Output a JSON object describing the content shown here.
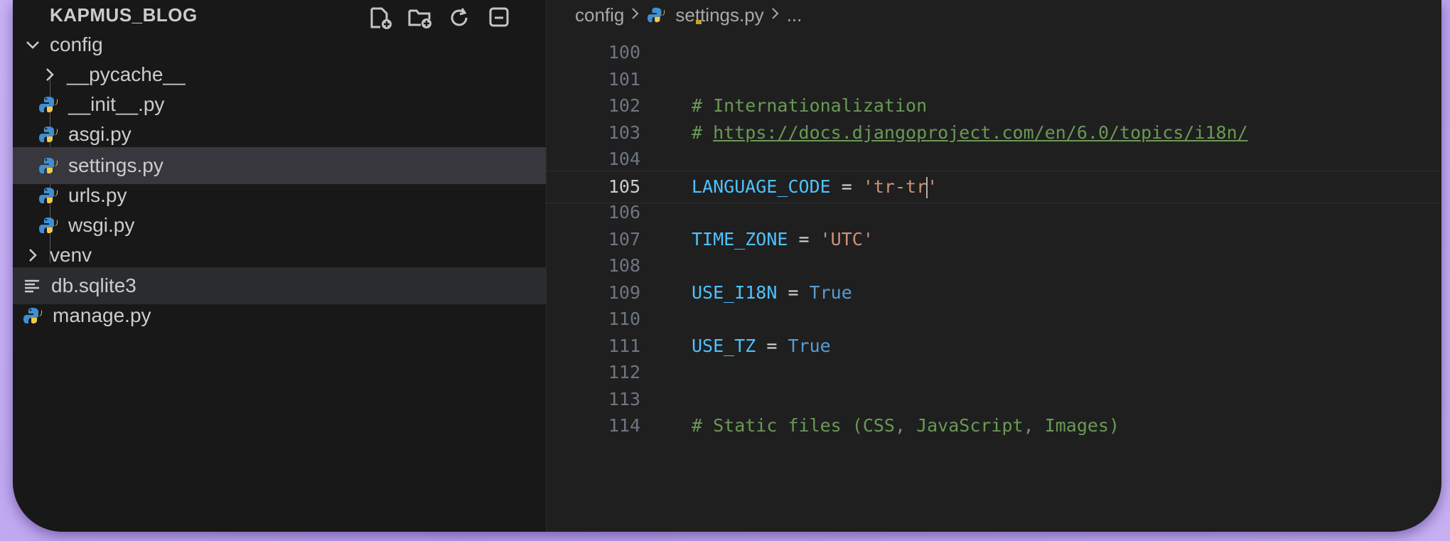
{
  "explorer": {
    "title": "KAPMUS_BLOG",
    "actions": [
      "new-file-icon",
      "new-folder-icon",
      "refresh-icon",
      "collapse-all-icon"
    ],
    "items": [
      {
        "label": "config",
        "kind": "folder",
        "expanded": true,
        "depth": 0
      },
      {
        "label": "__pycache__",
        "kind": "folder",
        "expanded": false,
        "depth": 1
      },
      {
        "label": "__init__.py",
        "kind": "python",
        "depth": 1
      },
      {
        "label": "asgi.py",
        "kind": "python",
        "depth": 1
      },
      {
        "label": "settings.py",
        "kind": "python",
        "depth": 1,
        "selected": true
      },
      {
        "label": "urls.py",
        "kind": "python",
        "depth": 1
      },
      {
        "label": "wsgi.py",
        "kind": "python",
        "depth": 1
      },
      {
        "label": "venv",
        "kind": "folder",
        "expanded": false,
        "depth": 0
      },
      {
        "label": "db.sqlite3",
        "kind": "database",
        "depth": 0
      },
      {
        "label": "manage.py",
        "kind": "python",
        "depth": 0
      }
    ]
  },
  "breadcrumb": {
    "folder": "config",
    "file": "settings.py",
    "more": "..."
  },
  "editor": {
    "current_line": "105",
    "lines": [
      {
        "n": "100",
        "tokens": []
      },
      {
        "n": "101",
        "tokens": []
      },
      {
        "n": "102",
        "tokens": [
          {
            "t": "comment",
            "v": "# Internationalization"
          }
        ]
      },
      {
        "n": "103",
        "tokens": [
          {
            "t": "comment",
            "v": "# "
          },
          {
            "t": "link",
            "v": "https://docs.djangoproject.com/en/6.0/topics/i18n/"
          }
        ]
      },
      {
        "n": "104",
        "tokens": []
      },
      {
        "n": "105",
        "tokens": [
          {
            "t": "var",
            "v": "LANGUAGE_CODE"
          },
          {
            "t": "op",
            "v": " = "
          },
          {
            "t": "str",
            "v": "'tr-tr"
          },
          {
            "t": "caret",
            "v": ""
          },
          {
            "t": "str",
            "v": "'"
          }
        ]
      },
      {
        "n": "106",
        "tokens": []
      },
      {
        "n": "107",
        "tokens": [
          {
            "t": "var",
            "v": "TIME_ZONE"
          },
          {
            "t": "op",
            "v": " = "
          },
          {
            "t": "str",
            "v": "'UTC'"
          }
        ]
      },
      {
        "n": "108",
        "tokens": []
      },
      {
        "n": "109",
        "tokens": [
          {
            "t": "var",
            "v": "USE_I18N"
          },
          {
            "t": "op",
            "v": " = "
          },
          {
            "t": "kw",
            "v": "True"
          }
        ]
      },
      {
        "n": "110",
        "tokens": []
      },
      {
        "n": "111",
        "tokens": [
          {
            "t": "var",
            "v": "USE_TZ"
          },
          {
            "t": "op",
            "v": " = "
          },
          {
            "t": "kw",
            "v": "True"
          }
        ]
      },
      {
        "n": "112",
        "tokens": []
      },
      {
        "n": "113",
        "tokens": []
      },
      {
        "n": "114",
        "tokens": [
          {
            "t": "comment",
            "v": "# Static files (CSS, JavaScript, Images)"
          }
        ]
      }
    ]
  },
  "colors": {
    "background": "#c1aaf2",
    "sidebar": "#181818",
    "editor": "#1f1f1f",
    "selected_row": "#37373d",
    "python_icon_blue": "#3f8fd2",
    "python_icon_yellow": "#f2c94c"
  }
}
